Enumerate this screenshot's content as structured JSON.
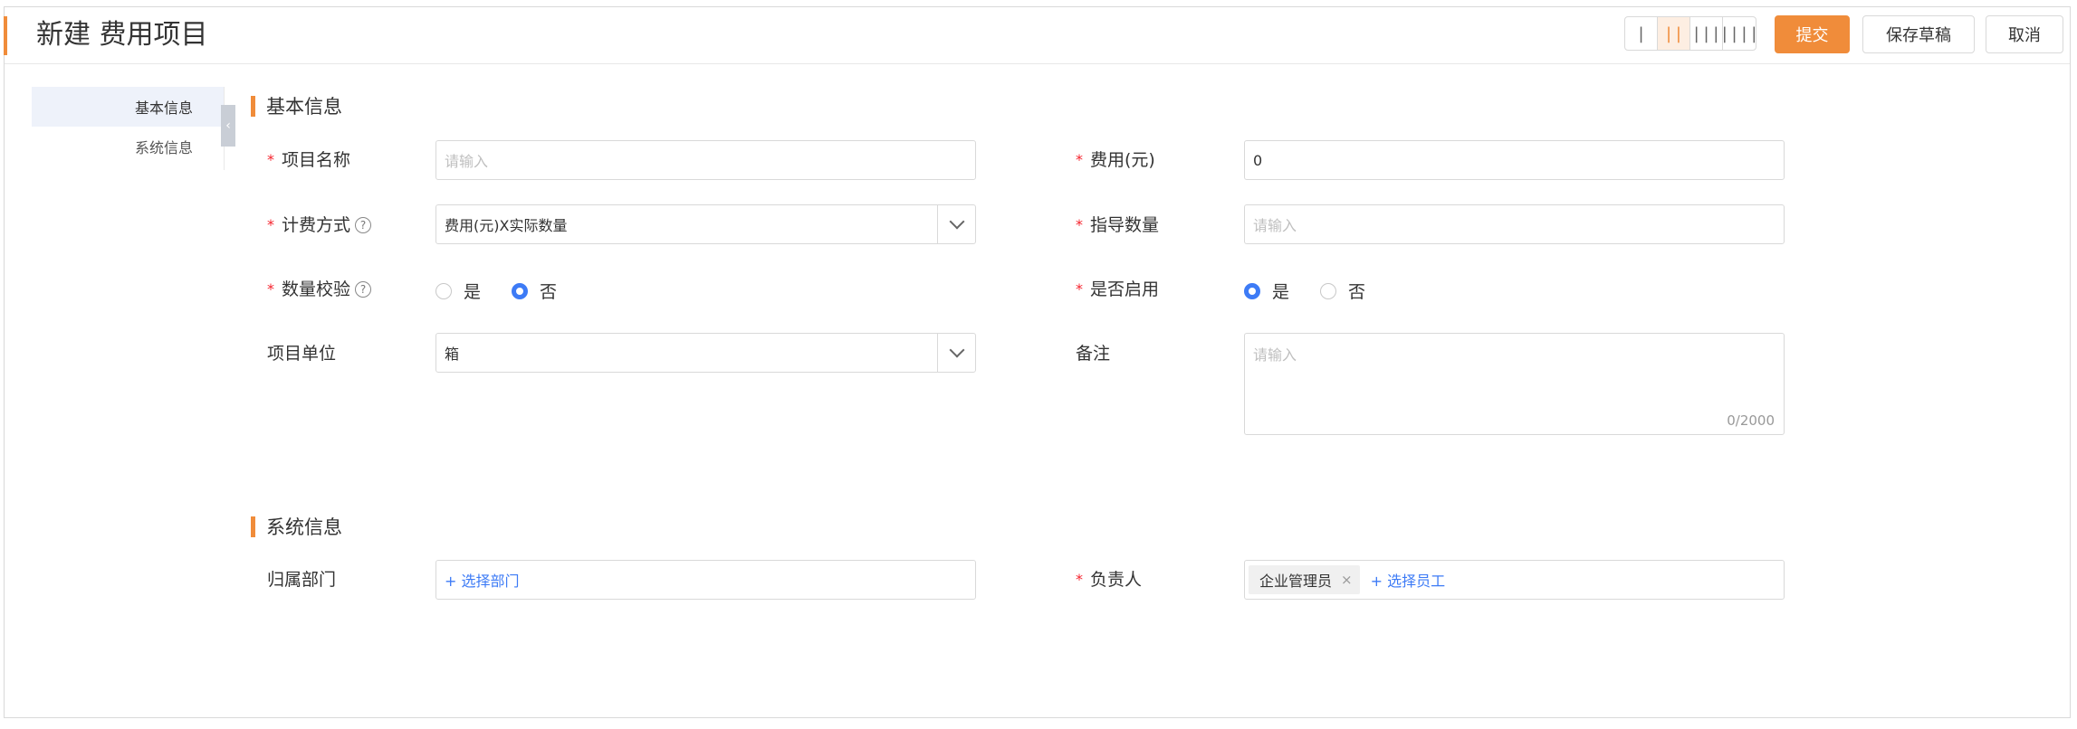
{
  "header": {
    "title": "新建 费用项目",
    "layout_options": [
      "|",
      "||",
      "|||",
      "||||"
    ],
    "layout_selected_index": 1,
    "submit_label": "提交",
    "save_draft_label": "保存草稿",
    "cancel_label": "取消"
  },
  "sidenav": {
    "items": [
      {
        "label": "基本信息",
        "active": true
      },
      {
        "label": "系统信息",
        "active": false
      }
    ],
    "collapse_glyph": "‹"
  },
  "sections": {
    "basic": {
      "title": "基本信息",
      "project_name": {
        "label": "项目名称",
        "required": "*",
        "placeholder": "请输入",
        "value": ""
      },
      "fee": {
        "label": "费用(元)",
        "required": "*",
        "value": "0"
      },
      "billing_method": {
        "label": "计费方式",
        "required": "*",
        "value": "费用(元)X实际数量"
      },
      "guide_quantity": {
        "label": "指导数量",
        "required": "*",
        "placeholder": "请输入"
      },
      "quantity_check": {
        "label": "数量校验",
        "required": "*",
        "options": [
          "是",
          "否"
        ],
        "selected": "否"
      },
      "enabled": {
        "label": "是否启用",
        "required": "*",
        "options": [
          "是",
          "否"
        ],
        "selected": "是"
      },
      "unit": {
        "label": "项目单位",
        "value": "箱"
      },
      "remarks": {
        "label": "备注",
        "placeholder": "请输入",
        "counter": "0/2000"
      }
    },
    "system": {
      "title": "系统信息",
      "department": {
        "label": "归属部门",
        "add_label": "+ 选择部门"
      },
      "owner": {
        "label": "负责人",
        "required": "*",
        "tag": "企业管理员",
        "tag_close": "×",
        "add_label": "+ 选择员工"
      }
    }
  },
  "icons": {
    "help": "?"
  },
  "colors": {
    "accent": "#f08c3a",
    "link": "#3d7bf6",
    "required": "#f5222d"
  }
}
